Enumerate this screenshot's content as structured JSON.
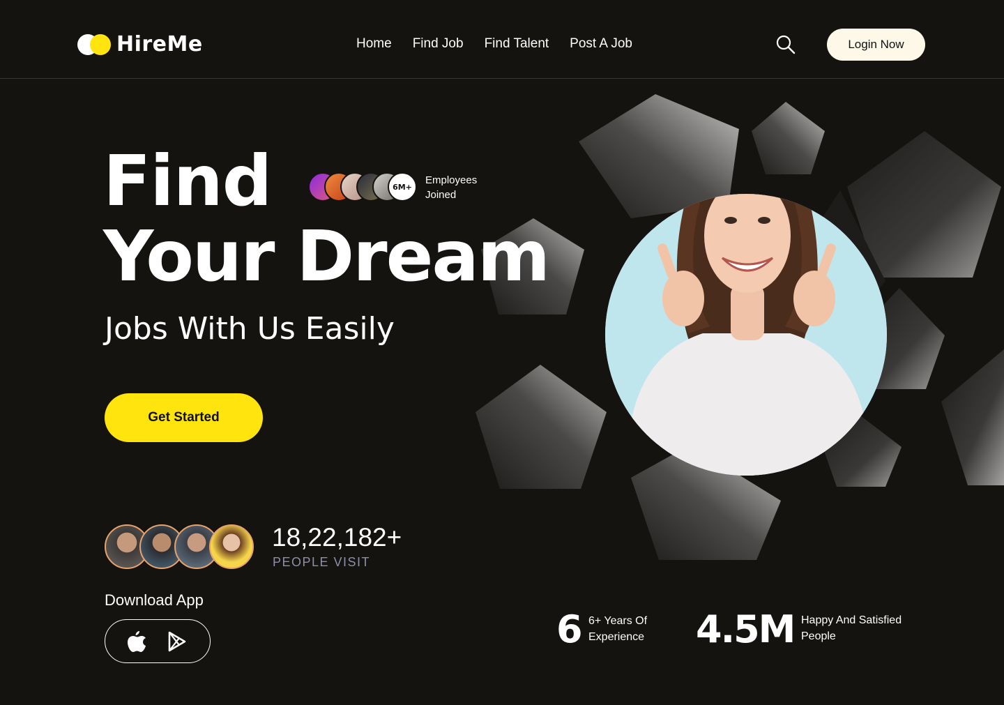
{
  "header": {
    "logo_text": "HireMe",
    "nav": [
      "Home",
      "Find Job",
      "Find Talent",
      "Post A Job"
    ],
    "search_icon": "search-icon",
    "login_label": "Login Now"
  },
  "hero": {
    "line1": "Find",
    "line2": "Your Dream",
    "line3": "Jobs With Us Easily",
    "employees_badge": "6M+",
    "employees_line1": "Employees",
    "employees_line2": "Joined",
    "cta_label": "Get Started"
  },
  "visitors": {
    "count": "18,22,182+",
    "label": "PEOPLE VISIT"
  },
  "download": {
    "title": "Download App",
    "apple_icon": "apple-icon",
    "play_icon": "google-play-icon"
  },
  "stats": [
    {
      "value": "6",
      "label_line1": "6+ Years Of",
      "label_line2": "Experience"
    },
    {
      "value": "4.5M",
      "label_line1": "Happy And Satisfied",
      "label_line2": "People"
    }
  ],
  "colors": {
    "background": "#15130f",
    "accent": "#ffe40e",
    "login_bg": "#fdf8e7",
    "photo_circle": "#bfe6ec",
    "muted_text": "#8e8fa8"
  }
}
